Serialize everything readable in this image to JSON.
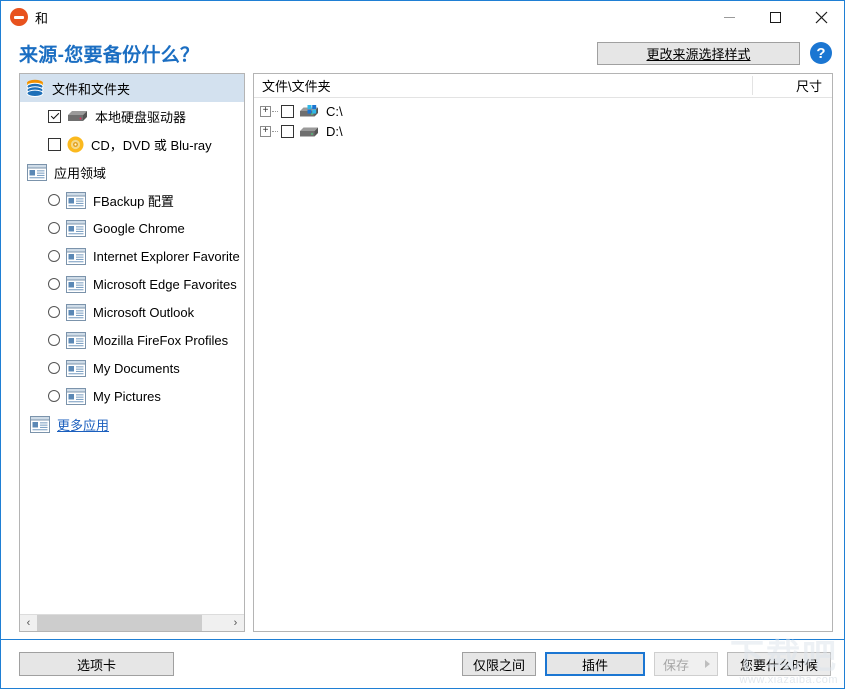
{
  "window": {
    "title": "和",
    "app_icon": "eject-circle-icon",
    "controls": {
      "minimize": "minimize-icon",
      "maximize": "maximize-icon",
      "close": "close-icon"
    }
  },
  "header": {
    "page_title": "来源-您要备份什么？",
    "change_style_button": "更改来源选择样式",
    "help_button": "?"
  },
  "left_panel": {
    "items": [
      {
        "label": "文件和文件夹",
        "icon": "files-folders-stack-icon",
        "control": "none",
        "selected": true,
        "indent": 0
      },
      {
        "label": "本地硬盘驱动器",
        "icon": "hard-drive-icon",
        "control": "checkbox",
        "checked": true,
        "indent": 1
      },
      {
        "label": "CD，DVD 或 Blu-ray",
        "icon": "optical-disc-icon",
        "control": "checkbox",
        "checked": false,
        "indent": 1
      },
      {
        "label": "应用领域",
        "icon": "application-window-icon",
        "control": "none",
        "selected": false,
        "indent": 0
      },
      {
        "label": "FBackup 配置",
        "icon": "application-window-icon",
        "control": "radio",
        "checked": false,
        "indent": 1
      },
      {
        "label": "Google Chrome",
        "icon": "application-window-icon",
        "control": "radio",
        "checked": false,
        "indent": 1
      },
      {
        "label": "Internet Explorer Favorite",
        "icon": "application-window-icon",
        "control": "radio",
        "checked": false,
        "indent": 1
      },
      {
        "label": "Microsoft Edge Favorites",
        "icon": "application-window-icon",
        "control": "radio",
        "checked": false,
        "indent": 1
      },
      {
        "label": "Microsoft Outlook",
        "icon": "application-window-icon",
        "control": "radio",
        "checked": false,
        "indent": 1
      },
      {
        "label": "Mozilla FireFox Profiles",
        "icon": "application-window-icon",
        "control": "radio",
        "checked": false,
        "indent": 1
      },
      {
        "label": "My Documents",
        "icon": "application-window-icon",
        "control": "radio",
        "checked": false,
        "indent": 1
      },
      {
        "label": "My Pictures",
        "icon": "application-window-icon",
        "control": "radio",
        "checked": false,
        "indent": 1
      }
    ],
    "more_apps_link": "更多应用",
    "more_apps_icon": "application-window-icon",
    "scrollbar": {
      "left_arrow": "‹",
      "right_arrow": "›"
    }
  },
  "right_panel": {
    "columns": {
      "name": "文件\\文件夹",
      "size": "尺寸"
    },
    "tree": [
      {
        "label": "C:\\",
        "expander": "+",
        "checked": false,
        "icon": "windows-drive-icon"
      },
      {
        "label": "D:\\",
        "expander": "+",
        "checked": false,
        "icon": "hard-drive-icon"
      }
    ]
  },
  "footer": {
    "tabs_button": "选项卡",
    "only_between_button": "仅限之间",
    "plugin_button": "插件",
    "save_button": "保存",
    "save_caret": "▶",
    "when_button": "您要什么时候"
  },
  "watermark": {
    "glyph": "下载吧",
    "url": "www.xiazaiba.com"
  },
  "colors": {
    "accent": "#1b76d2",
    "title_blue": "#1b6ec2",
    "selection": "#d3e1ef",
    "brand_orange": "#e8521e",
    "link": "#1b5fbe"
  }
}
